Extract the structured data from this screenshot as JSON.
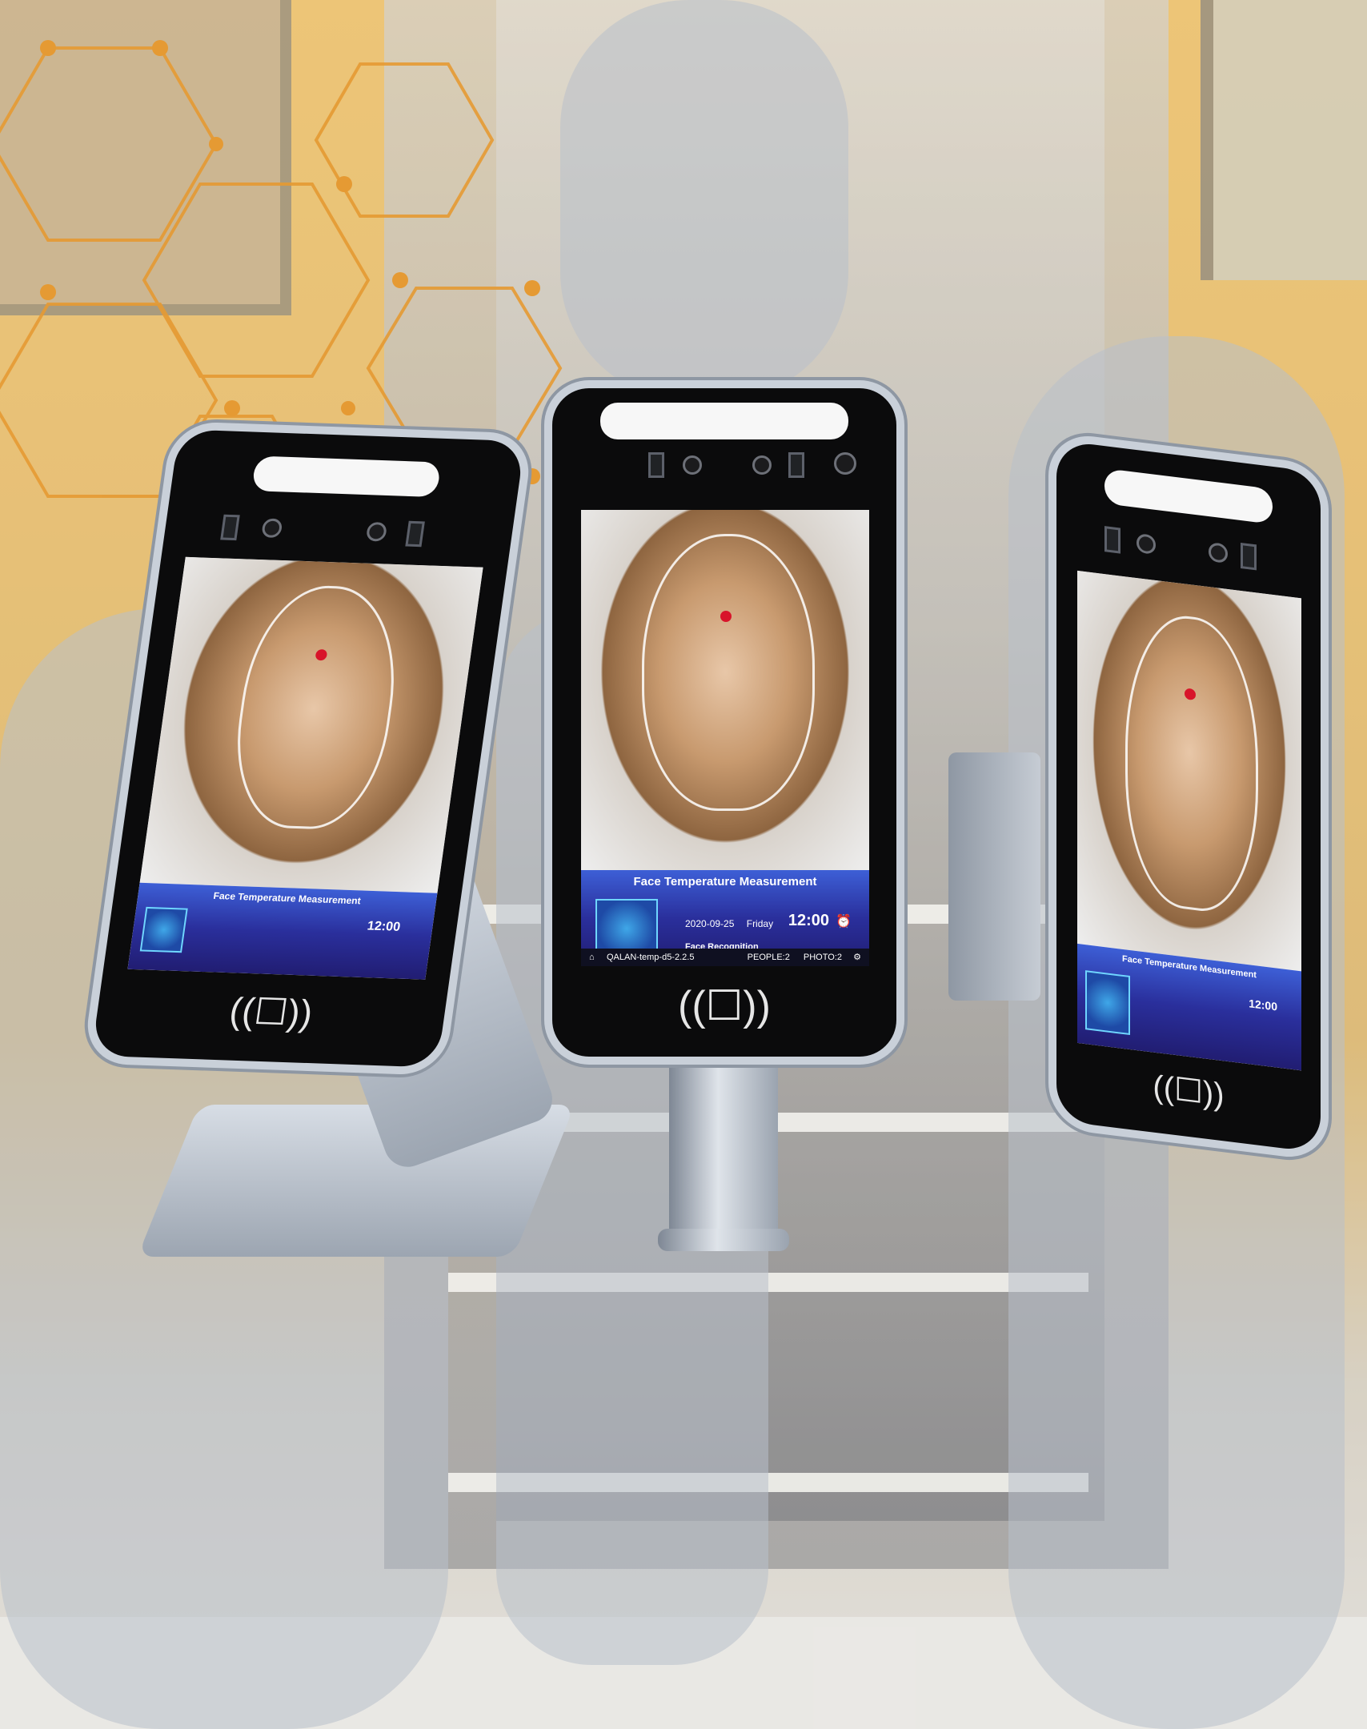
{
  "devices": {
    "center": {
      "panel_title": "Face Temperature Measurement",
      "date": "2020-09-25",
      "weekday": "Friday",
      "time": "12:00",
      "recognition_label": "Face Recognition",
      "version": "QALAN-temp-d5-2.2.5",
      "people": "PEOPLE:2",
      "photo": "PHOTO:2"
    },
    "left": {
      "panel_title": "Face Temperature Measurement",
      "time": "12:00"
    },
    "right": {
      "panel_title": "Face Temperature Measurement",
      "time": "12:00"
    }
  },
  "icons": {
    "nfc": "contactless-card-icon",
    "alarm": "alarm-clock-icon",
    "home": "home-icon",
    "settings": "gear-icon"
  },
  "colors": {
    "accent": "#e59a33",
    "temperature_dot": "#d8142a",
    "panel_blue": "#2a2f9c"
  }
}
